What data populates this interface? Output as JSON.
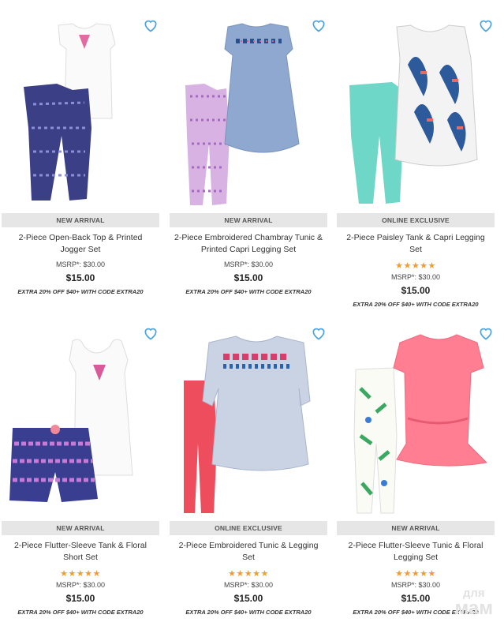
{
  "products": [
    {
      "badge": "NEW ARRIVAL",
      "title": "2-Piece Open-Back Top & Printed Jogger Set",
      "stars": "",
      "msrp": "MSRP*: $30.00",
      "price": "$15.00",
      "promo": "EXTRA 20% OFF $40+ WITH CODE EXTRA20"
    },
    {
      "badge": "NEW ARRIVAL",
      "title": "2-Piece Embroidered Chambray Tunic & Printed Capri Legging Set",
      "stars": "",
      "msrp": "MSRP*: $30.00",
      "price": "$15.00",
      "promo": "EXTRA 20% OFF $40+ WITH CODE EXTRA20"
    },
    {
      "badge": "ONLINE EXCLUSIVE",
      "title": "2-Piece Paisley Tank & Capri Legging Set",
      "stars": "★★★★★",
      "msrp": "MSRP*: $30.00",
      "price": "$15.00",
      "promo": "EXTRA 20% OFF $40+ WITH CODE EXTRA20"
    },
    {
      "badge": "NEW ARRIVAL",
      "title": "2-Piece Flutter-Sleeve Tank & Floral Short Set",
      "stars": "★★★★★",
      "msrp": "MSRP*: $30.00",
      "price": "$15.00",
      "promo": "EXTRA 20% OFF $40+ WITH CODE EXTRA20"
    },
    {
      "badge": "ONLINE EXCLUSIVE",
      "title": "2-Piece Embroidered Tunic & Legging Set",
      "stars": "★★★★★",
      "msrp": "MSRP*: $30.00",
      "price": "$15.00",
      "promo": "EXTRA 20% OFF $40+ WITH CODE EXTRA20"
    },
    {
      "badge": "NEW ARRIVAL",
      "title": "2-Piece Flutter-Sleeve Tunic & Floral Legging Set",
      "stars": "★★★★★",
      "msrp": "MSRP*: $30.00",
      "price": "$15.00",
      "promo": "EXTRA 20% OFF $40+ WITH CODE EXTRA20"
    }
  ],
  "watermark": {
    "line1": "для",
    "line2": "мам"
  },
  "colors": {
    "heart": "#4aa3df",
    "stars": "#f39c2a",
    "badge_bg": "#e6e6e6"
  }
}
